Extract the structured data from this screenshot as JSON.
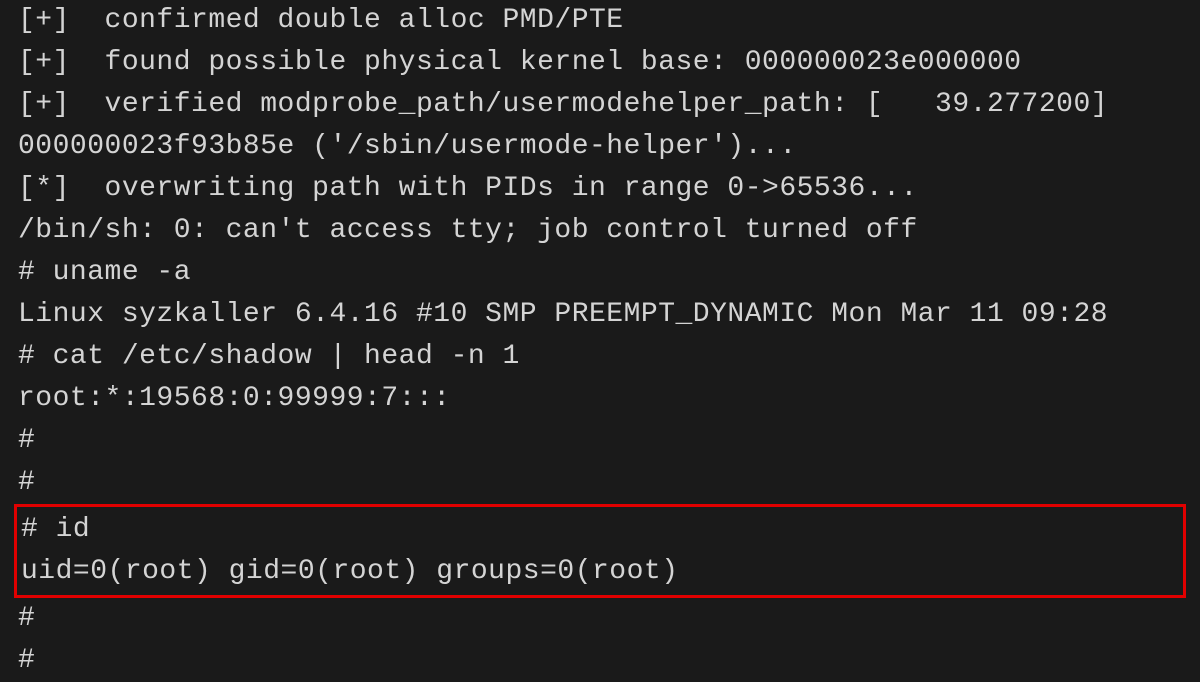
{
  "terminal": {
    "lines": [
      "[+]  confirmed double alloc PMD/PTE",
      "[+]  found possible physical kernel base: 000000023e000000",
      "[+]  verified modprobe_path/usermodehelper_path: [   39.277200]",
      "000000023f93b85e ('/sbin/usermode-helper')...",
      "[*]  overwriting path with PIDs in range 0->65536...",
      "/bin/sh: 0: can't access tty; job control turned off",
      "# uname -a",
      "Linux syzkaller 6.4.16 #10 SMP PREEMPT_DYNAMIC Mon Mar 11 09:28",
      "# cat /etc/shadow | head -n 1",
      "root:*:19568:0:99999:7:::",
      "#",
      "#"
    ],
    "highlighted": [
      "# id",
      "uid=0(root) gid=0(root) groups=0(root)"
    ],
    "trailing": [
      "#",
      "#"
    ]
  }
}
